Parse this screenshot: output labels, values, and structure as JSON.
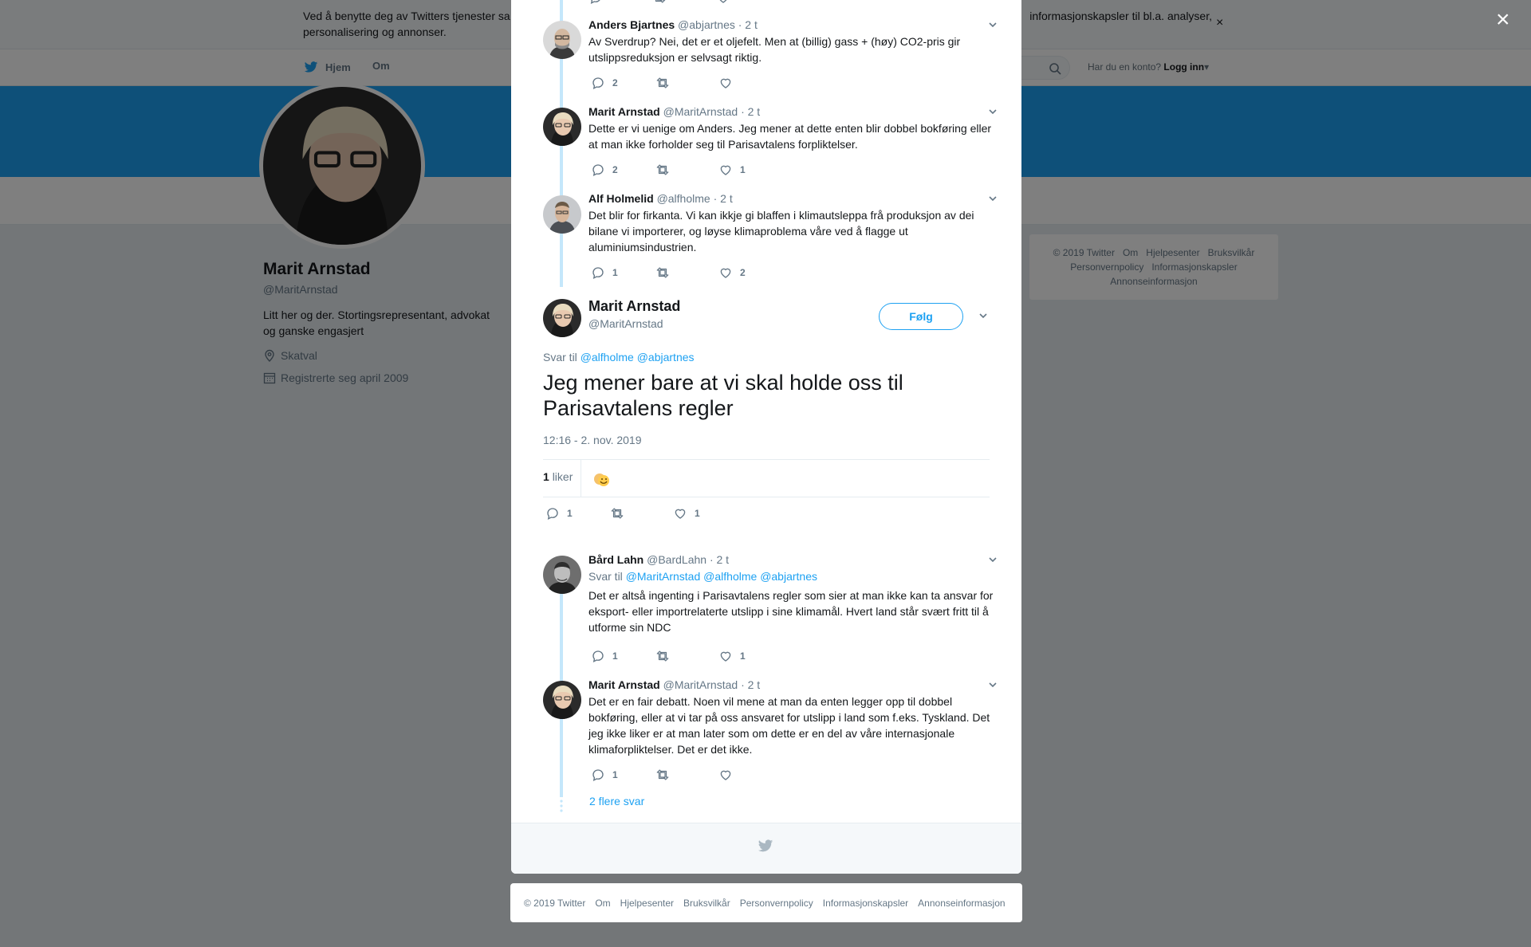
{
  "cookie": {
    "text": "Ved å benytte deg av Twitters tjenester sa",
    "text_tail": "informasjonskapsler til bl.a. analyser,",
    "text_line2": "personalisering og annonser.",
    "close": "×"
  },
  "nav": {
    "home": "Hjem",
    "about": "Om",
    "have_account": "Har du en konto?",
    "login": "Logg inn"
  },
  "profile": {
    "name": "Marit Arnstad",
    "handle": "@MaritArnstad",
    "bio": "Litt her og der. Stortingsrepresentant, advokat og ganske engasjert",
    "location": "Skatval",
    "joined": "Registrerte seg april 2009"
  },
  "side_footer": {
    "line1": [
      "© 2019 Twitter",
      "Om",
      "Hjelpesenter",
      "Bruksvilkår"
    ],
    "line2": [
      "Personvernpolicy",
      "Informasjonskapsler"
    ],
    "line3": [
      "Annonseinformasjon"
    ]
  },
  "modal": {
    "close": "×",
    "replies_above": [
      {
        "name": "Anders Bjartnes",
        "handle": "@abjartnes",
        "time": "· 2 t",
        "text": "Av Sverdrup? Nei, det er et oljefelt. Men at (billig) gass + (høy) CO2-pris gir utslippsreduksjon er selvsagt riktig.",
        "replies": "2",
        "retweets": "",
        "likes": ""
      },
      {
        "name": "Marit Arnstad",
        "handle": "@MaritArnstad",
        "time": "· 2 t",
        "text": "Dette er vi uenige om Anders. Jeg mener at dette enten blir dobbel bokføring eller at man ikke forholder seg til Parisavtalens forpliktelser.",
        "replies": "2",
        "retweets": "",
        "likes": "1"
      },
      {
        "name": "Alf Holmelid",
        "handle": "@alfholme",
        "time": "· 2 t",
        "text": "Det blir for firkanta. Vi kan ikkje gi blaffen i klimautsleppa frå produksjon av dei bilane vi importerer, og løyse klimaproblema våre ved å flagge ut aluminiumsindustrien.",
        "replies": "1",
        "retweets": "",
        "likes": "2"
      }
    ],
    "main": {
      "name": "Marit Arnstad",
      "handle": "@MaritArnstad",
      "follow": "Følg",
      "reply_to_label": "Svar til",
      "reply_to": [
        "@alfholme",
        "@abjartnes"
      ],
      "text": "Jeg mener bare at vi skal holde oss til Parisavtalens regler",
      "timestamp": "12:16 - 2. nov. 2019",
      "likes_count": "1",
      "likes_label": "liker",
      "replies": "1",
      "retweets": "",
      "likes": "1"
    },
    "replies_below": [
      {
        "name": "Bård Lahn",
        "handle": "@BardLahn",
        "time": "· 2 t",
        "reply_to_label": "Svar til",
        "reply_to": [
          "@MaritArnstad",
          "@alfholme",
          "@abjartnes"
        ],
        "text": "Det er altså ingenting i Parisavtalens regler som sier at man ikke kan ta ansvar for eksport- eller importrelaterte utslipp i sine klimamål. Hvert land står svært fritt til å utforme sin NDC",
        "replies": "1",
        "retweets": "",
        "likes": "1"
      },
      {
        "name": "Marit Arnstad",
        "handle": "@MaritArnstad",
        "time": "· 2 t",
        "text": "Det er en fair debatt. Noen vil mene at man da enten legger opp til dobbel bokføring, eller at vi tar på oss ansvaret for utslipp i land som f.eks. Tyskland. Det jeg ikke liker er at man later som om dette er en del av våre internasjonale klimaforpliktelser. Det er det ikke.",
        "replies": "1",
        "retweets": "",
        "likes": ""
      }
    ],
    "more_replies": "2 flere svar"
  },
  "bottom_footer": [
    "© 2019 Twitter",
    "Om",
    "Hjelpesenter",
    "Bruksvilkår",
    "Personvernpolicy",
    "Informasjonskapsler",
    "Annonseinformasjon"
  ],
  "colors": {
    "accent": "#1da1f2",
    "thread": "#c4e7fb",
    "muted": "#657786"
  }
}
